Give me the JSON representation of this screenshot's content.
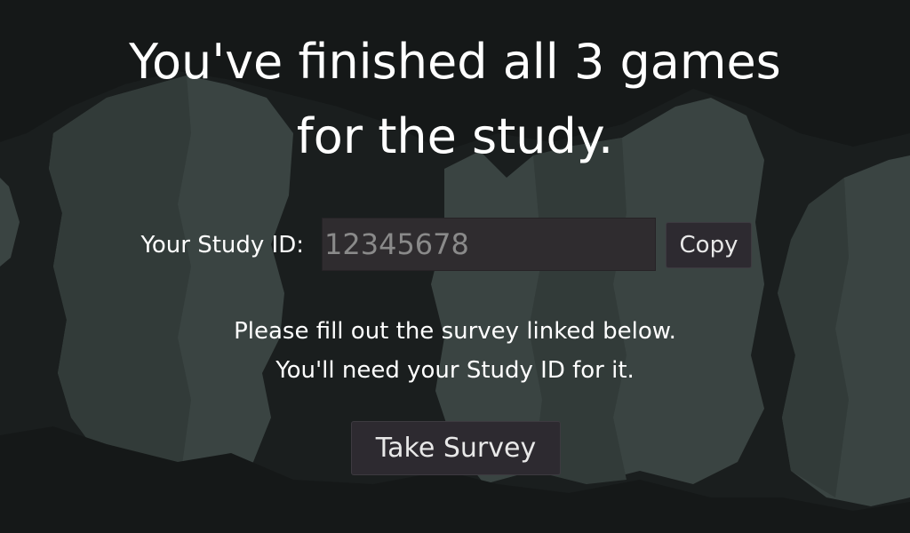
{
  "completion": {
    "title_line1": "You've finished all 3 games",
    "title_line2": "for the study."
  },
  "study_id": {
    "label": "Your Study ID:",
    "value": "12345678",
    "copy_label": "Copy"
  },
  "instructions": {
    "line1": "Please fill out the survey linked below.",
    "line2": "You'll need your Study ID for it."
  },
  "survey": {
    "button_label": "Take Survey"
  },
  "colors": {
    "background": "#1a1e1e",
    "rock": "#3a4442",
    "button_bg": "#2d2a30",
    "field_bg": "#2f2c2f",
    "text": "#ffffff",
    "field_text": "#8a8a8a"
  }
}
